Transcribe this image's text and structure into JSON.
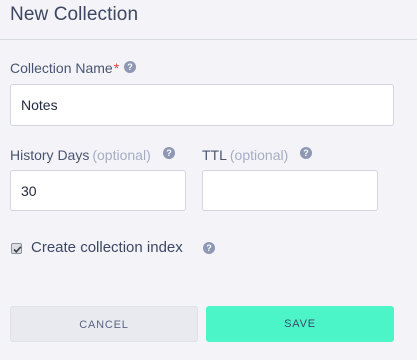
{
  "header": {
    "title": "New Collection"
  },
  "fields": {
    "collection_name": {
      "label": "Collection Name",
      "required_mark": "*",
      "value": "Notes",
      "help_icon": "question-icon"
    },
    "history_days": {
      "label": "History Days",
      "optional": "(optional)",
      "value": "30",
      "help_icon": "question-icon"
    },
    "ttl": {
      "label": "TTL",
      "optional": "(optional)",
      "value": "",
      "help_icon": "question-icon"
    }
  },
  "index_option": {
    "label": "Create collection index",
    "checked": true,
    "help_icon": "question-icon"
  },
  "actions": {
    "cancel_label": "CANCEL",
    "save_label": "SAVE"
  },
  "colors": {
    "accent": "#4cf5c8",
    "required": "#e0433a"
  }
}
